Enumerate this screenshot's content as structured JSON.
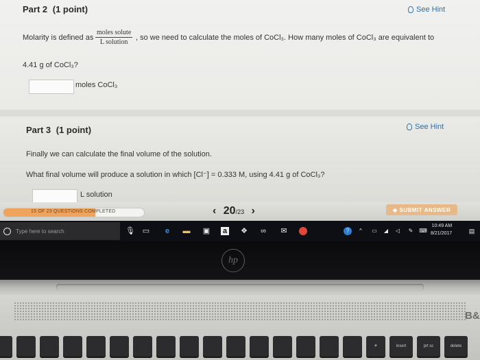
{
  "part2": {
    "title": "Part 2",
    "points": "(1 point)",
    "hint": "See Hint",
    "text_before": "Molarity is defined as",
    "fraction_num": "moles solute",
    "fraction_den": "L solution",
    "text_after": ", so we need to calculate the moles of CoCl₃. How many moles of CoCl₃ are equivalent to",
    "text_line2": "4.41 g of CoCl₃?",
    "answer_value": "",
    "unit": "moles CoCl₃"
  },
  "part3": {
    "title": "Part 3",
    "points": "(1 point)",
    "hint": "See Hint",
    "line1": "Finally we can calculate the final volume of the solution.",
    "line2": "What final volume will produce a solution in which [Cl⁻] = 0.333 M, using 4.41 g of CoCl₃?",
    "answer_value": "",
    "unit": "L solution"
  },
  "footer": {
    "progress_label": "15 OF 23 QUESTIONS COMPLETED",
    "progress_fraction": 0.652,
    "page_current": "20",
    "page_total": "/23",
    "submit_label": "SUBMIT ANSWER"
  },
  "taskbar": {
    "search_placeholder": "Type here to search",
    "time": "10:49 AM",
    "date": "8/21/2017"
  },
  "laptop": {
    "brand": "hp",
    "keys": [
      "insert",
      "prt sc",
      "delete"
    ]
  }
}
